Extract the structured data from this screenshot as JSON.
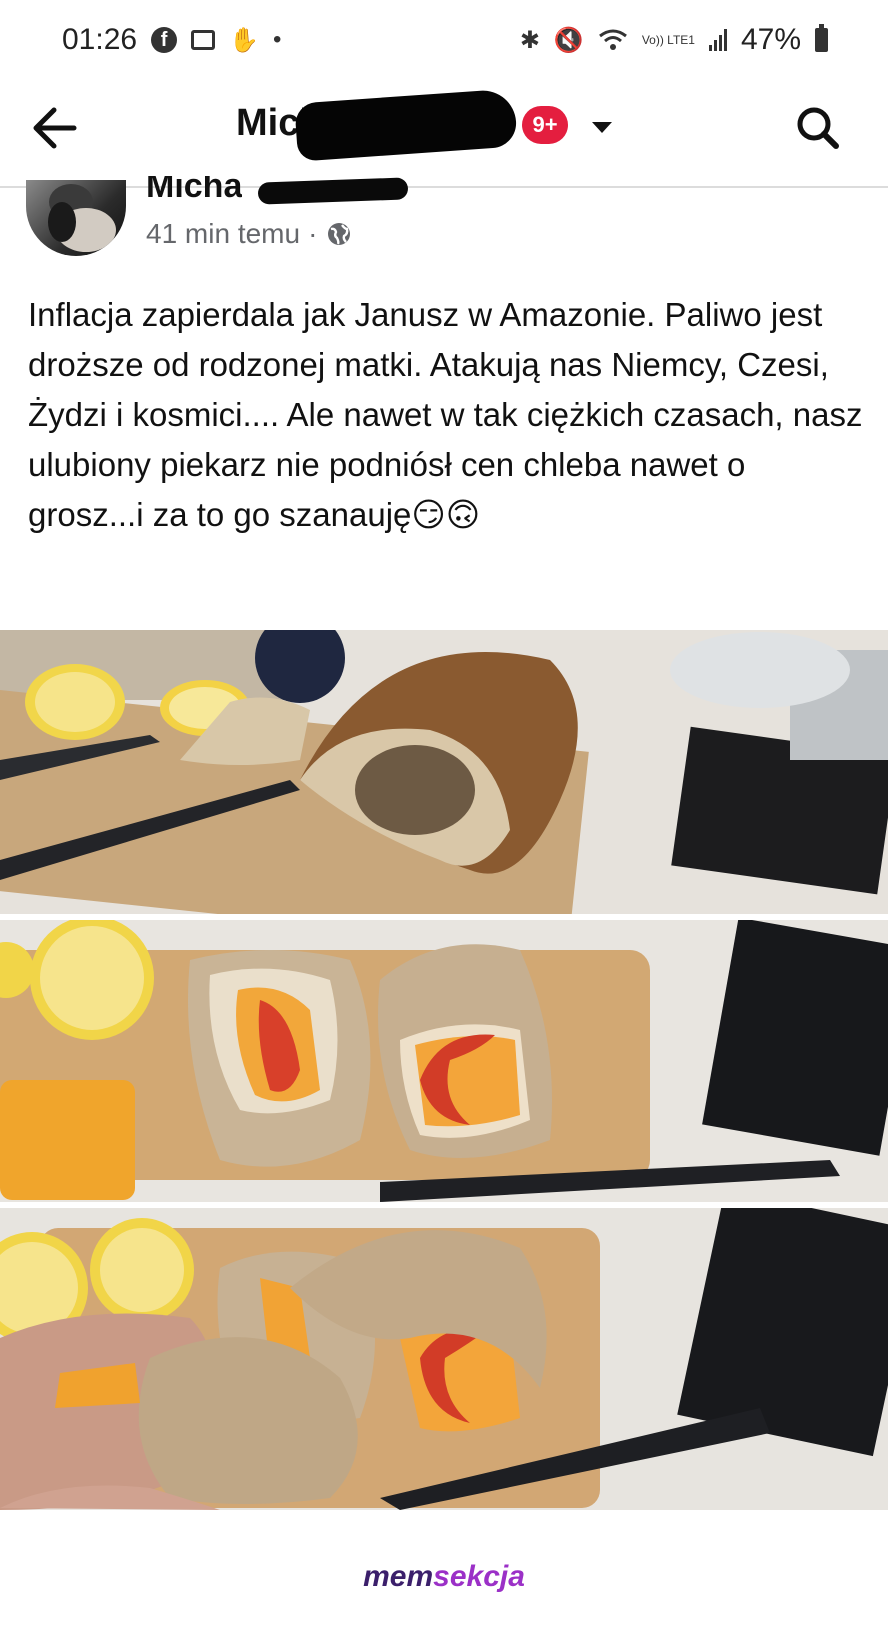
{
  "status_bar": {
    "time": "01:26",
    "battery": "47%",
    "network": "Vo)) LTE1",
    "icons": [
      "facebook-icon",
      "gallery-icon",
      "hand-icon",
      "dot-icon",
      "bluetooth-icon",
      "mute-icon",
      "wifi-icon",
      "signal-icon",
      "battery-icon"
    ]
  },
  "nav": {
    "title": "Mich",
    "badge": "9+",
    "icons": [
      "back-arrow-icon",
      "caret-down-icon",
      "search-icon"
    ]
  },
  "post": {
    "author_visible": "Micha",
    "time": "41 min temu",
    "separator": "·",
    "text": "Inflacja zapierdala jak Janusz w Amazonie. Paliwo jest droższe od rodzonej matki. Atakują nas Niemcy, Czesi, Żydzi i kosmici.... Ale nawet w tak ciężkich czasach, nasz ulubiony piekarz nie podniósł cen chleba nawet o grosz...i za to go szanauję😏🙃"
  },
  "photos": {
    "photo_1_alt": "hollow bread loaf",
    "photo_2_alt": "bread halves with cheese and pepper",
    "photo_3_alt": "hollow bread slice in hand"
  },
  "watermark": {
    "part1": "mem",
    "part2": "sekcja"
  },
  "colors": {
    "badge": "#e41e3f",
    "watermark_dark": "#3b1f6b",
    "watermark_light": "#9b30c7"
  }
}
